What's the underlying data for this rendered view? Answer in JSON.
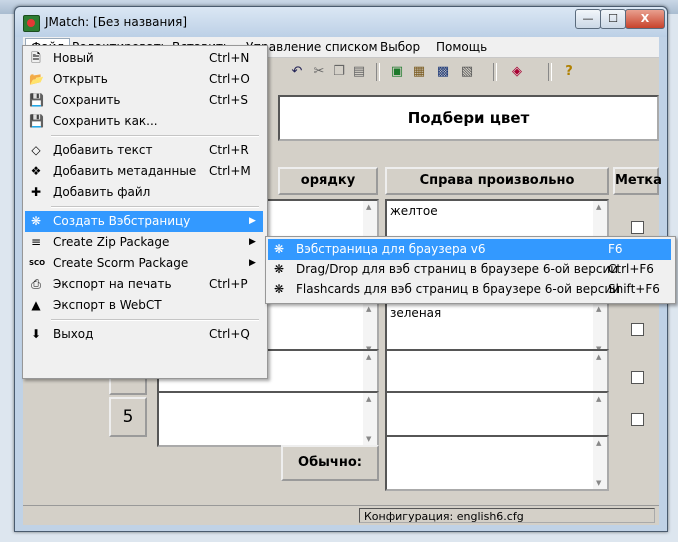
{
  "window": {
    "title": "JMatch: [Без названия]",
    "min_glyph": "—",
    "max_glyph": "☐",
    "close_glyph": "X"
  },
  "menubar": [
    "Файл",
    "Редактировать",
    "Вставить",
    "Управление списком",
    "Выбор",
    "Помощь"
  ],
  "toolbar_icons": [
    "undo-icon",
    "cut-icon",
    "copy-icon",
    "paste-icon",
    "web-page-icon",
    "drag-drop-icon",
    "flashcards-icon",
    "scorm-icon",
    "color-icon",
    "help-icon"
  ],
  "exercise_title": "Подбери цвет",
  "headers": {
    "left": "орядку",
    "right": "Справа произвольно",
    "mark": "Метка"
  },
  "rows": [
    {
      "num": "",
      "right": "желтое"
    },
    {
      "num": "",
      "right": ""
    },
    {
      "num": "",
      "right": "зеленая"
    },
    {
      "num": "",
      "right": ""
    },
    {
      "num": "5",
      "right": ""
    }
  ],
  "default_label": "Обычно:",
  "status": "Конфигурация: english6.cfg",
  "file_menu": [
    {
      "icon": "new-file-icon",
      "glyph": "🗎",
      "label": "Новый",
      "shortcut": "Ctrl+N"
    },
    {
      "icon": "open-folder-icon",
      "glyph": "📂",
      "label": "Открыть",
      "shortcut": "Ctrl+O"
    },
    {
      "icon": "save-icon",
      "glyph": "💾",
      "label": "Сохранить",
      "shortcut": "Ctrl+S"
    },
    {
      "icon": "save-as-icon",
      "glyph": "💾",
      "label": "Сохранить как...",
      "shortcut": ""
    },
    {
      "icon": "add-text-icon",
      "glyph": "◇",
      "label": "Добавить текст",
      "shortcut": "Ctrl+R"
    },
    {
      "icon": "metadata-icon",
      "glyph": "❖",
      "label": "Добавить метаданные",
      "shortcut": "Ctrl+M"
    },
    {
      "icon": "add-file-icon",
      "glyph": "✚",
      "label": "Добавить файл",
      "shortcut": ""
    },
    {
      "icon": "web-page-icon",
      "glyph": "❋",
      "label": "Создать Вэбстраницу",
      "shortcut": ""
    },
    {
      "icon": "zip-icon",
      "glyph": "≡",
      "label": "Create Zip Package",
      "shortcut": ""
    },
    {
      "icon": "scorm-icon",
      "glyph": "SCO",
      "label": "Create Scorm Package",
      "shortcut": ""
    },
    {
      "icon": "print-icon",
      "glyph": "⎙",
      "label": "Экспорт на печать",
      "shortcut": "Ctrl+P"
    },
    {
      "icon": "webct-icon",
      "glyph": "▲",
      "label": "Экспорт в WebCT",
      "shortcut": ""
    },
    {
      "icon": "exit-icon",
      "glyph": "⬇",
      "label": "Выход",
      "shortcut": "Ctrl+Q"
    }
  ],
  "sub_menu": [
    {
      "icon": "web-page-icon",
      "glyph": "❋",
      "label": "Вэбстраница для браузера v6",
      "shortcut": "F6"
    },
    {
      "icon": "drag-drop-icon",
      "glyph": "❋",
      "label": "Drag/Drop для вэб страниц в браузере 6-ой версии",
      "shortcut": "Ctrl+F6"
    },
    {
      "icon": "flashcards-icon",
      "glyph": "❋",
      "label": "Flashcards для вэб страниц в браузере 6-ой версии",
      "shortcut": "Shift+F6"
    }
  ],
  "colors": {
    "highlight": "#3399ff",
    "menu_bg": "#f0f0f0",
    "face": "#d4d0c8"
  }
}
